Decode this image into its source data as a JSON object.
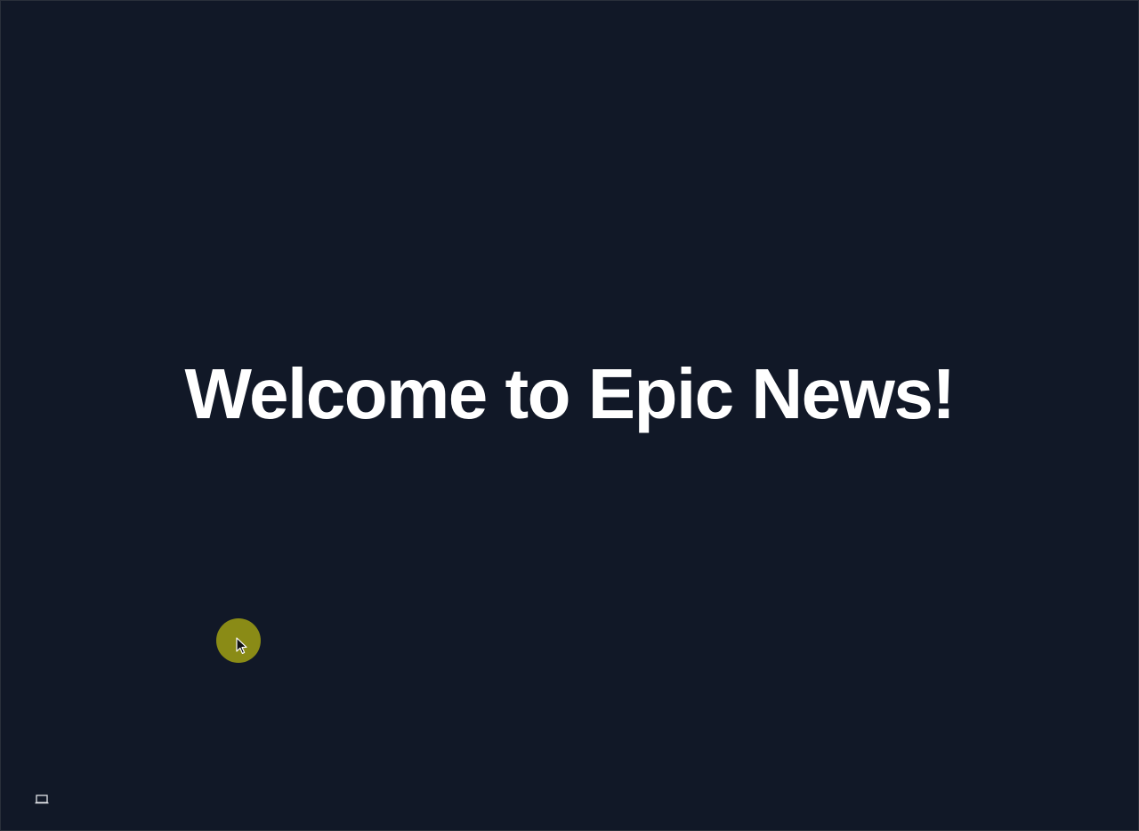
{
  "page": {
    "background_color": "#111827",
    "heading": "Welcome to Epic News!"
  },
  "cursor": {
    "highlight_color": "#a0a014",
    "icon": "mouse-pointer-icon"
  },
  "footer": {
    "device_toggle_icon": "laptop-icon"
  }
}
